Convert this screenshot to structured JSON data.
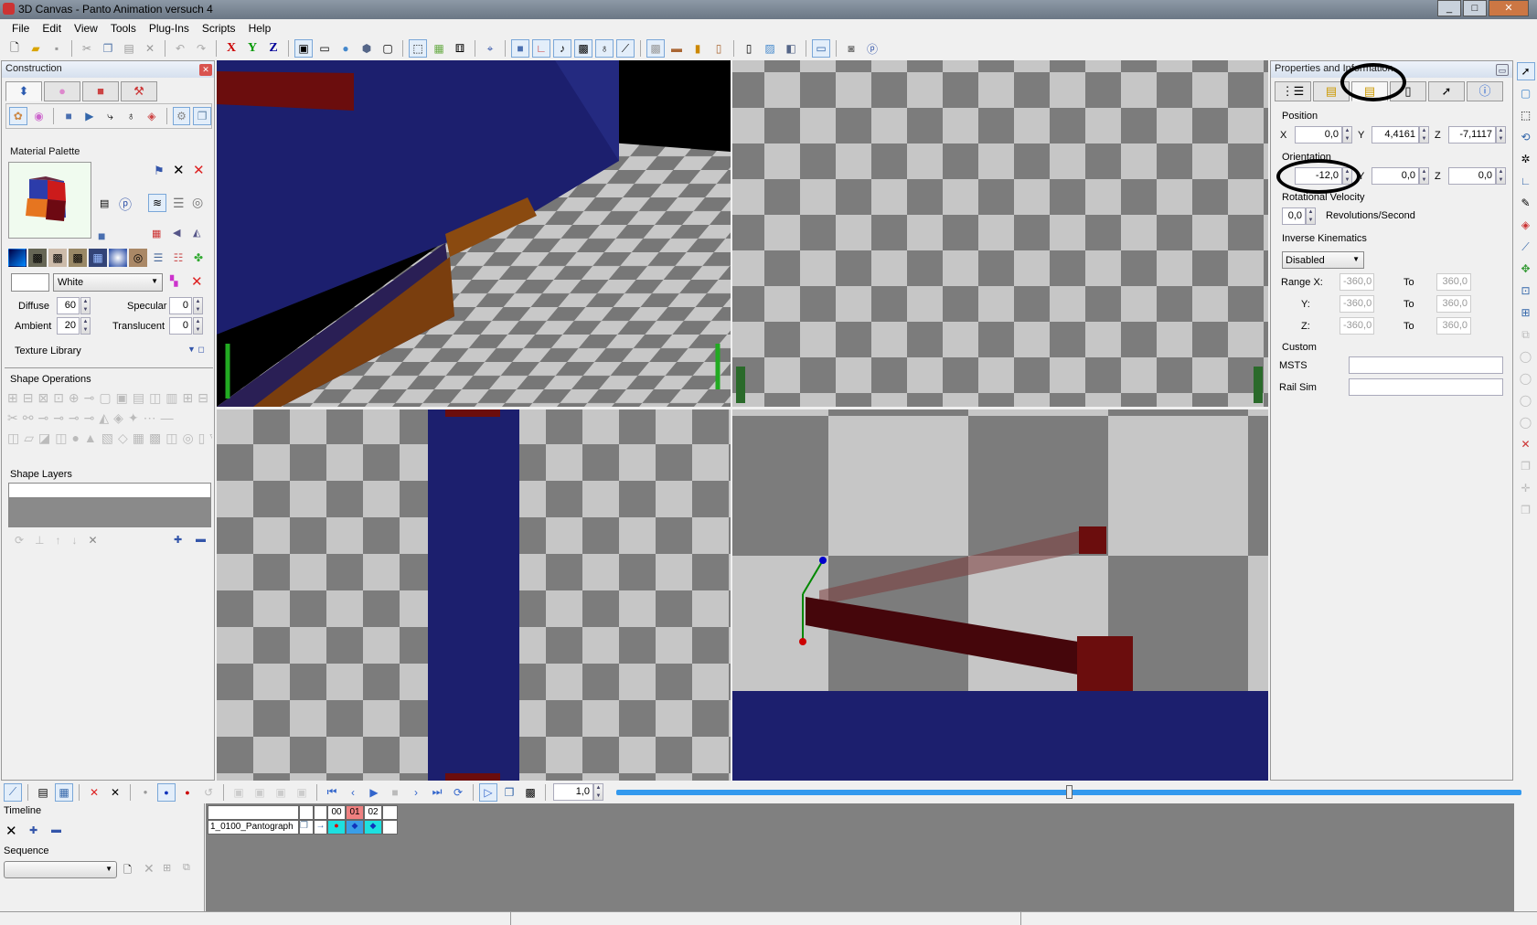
{
  "window": {
    "title": "3D Canvas - Panto Animation versuch 4",
    "min": "_",
    "max": "□",
    "close": "✕"
  },
  "menu": [
    "File",
    "Edit",
    "View",
    "Tools",
    "Plug-Ins",
    "Scripts",
    "Help"
  ],
  "toolbar": {
    "axis_x": "X",
    "axis_y": "Y",
    "axis_z": "Z"
  },
  "construction": {
    "title": "Construction",
    "material_palette": "Material Palette",
    "color_name": "White",
    "diffuse_label": "Diffuse",
    "diffuse": "60",
    "ambient_label": "Ambient",
    "ambient": "20",
    "specular_label": "Specular",
    "specular": "0",
    "translucent_label": "Translucent",
    "translucent": "0",
    "texture_library": "Texture Library",
    "shape_operations": "Shape Operations",
    "shape_layers": "Shape Layers"
  },
  "properties": {
    "title": "Properties and Information",
    "position": "Position",
    "pos_x": "0,0",
    "pos_y": "4,4161",
    "pos_z": "-7,1117",
    "orientation": "Orientation",
    "or_x": "-12,0",
    "or_y": "0,0",
    "or_z": "0,0",
    "rot_vel_label": "Rotational Velocity",
    "rot_vel": "0,0",
    "rot_unit": "Revolutions/Second",
    "ik_label": "Inverse Kinematics",
    "ik_mode": "Disabled",
    "range_x": "Range X:",
    "range_y": "Y:",
    "range_z": "Z:",
    "to": "To",
    "min": "-360,0",
    "max": "360,0",
    "custom": "Custom",
    "msts": "MSTS",
    "railsim": "Rail Sim",
    "lx": "X",
    "ly": "Y",
    "lz": "Z"
  },
  "animation": {
    "speed": "1,0",
    "timeline": "Timeline",
    "sequence": "Sequence",
    "track_name": "1_0100_Pantograph",
    "frames": [
      "00",
      "01",
      "02"
    ]
  },
  "colors": {
    "navy": "#1c1f6e",
    "darkred": "#6b0d0d",
    "accent": "#3399ee"
  }
}
